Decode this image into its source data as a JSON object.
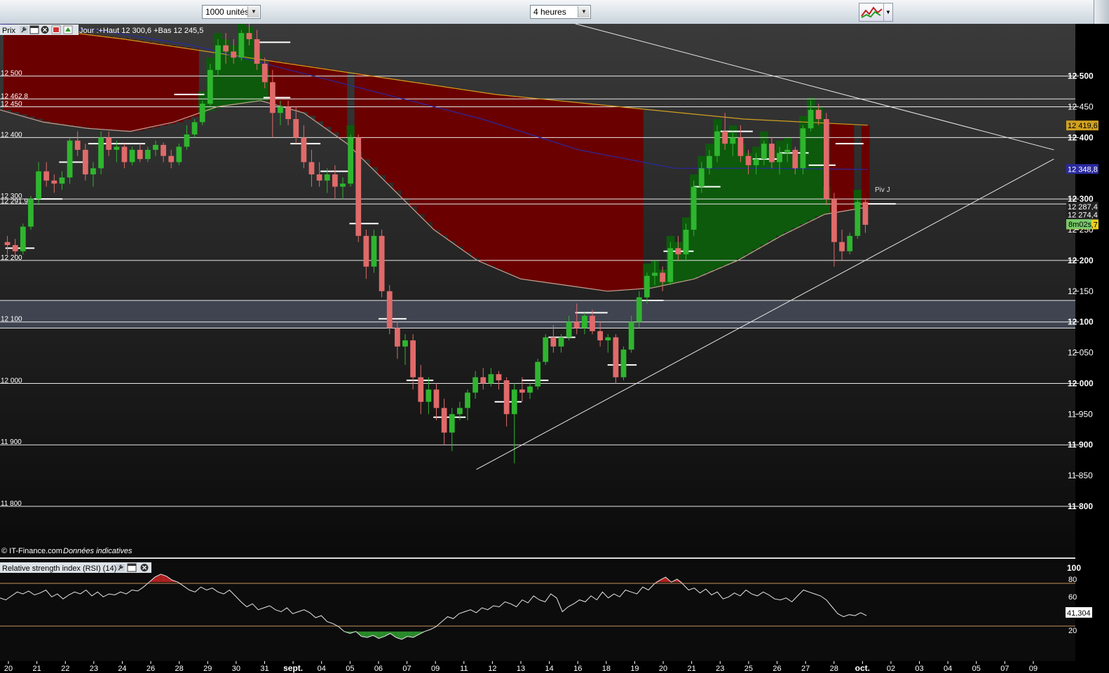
{
  "toolbar": {
    "units_select": "1000 unités",
    "interval_select": "4 heures"
  },
  "price_panel": {
    "label": "Prix",
    "info": "Jour :+Haut 12 300,6 +Bas 12 245,5",
    "copyright": "© IT-Finance.com",
    "disclaimer": "Données indicatives",
    "pivot_label": "Piv J",
    "timer": "8m02s"
  },
  "rsi_panel": {
    "label": "Relative strength index (RSI) (14)",
    "value_label": "41,304",
    "ticks": [
      "100",
      "80",
      "60",
      "20"
    ]
  },
  "colors": {
    "up": "#2fb52f",
    "down": "#e06a6a",
    "ma_slow": "#d0a020",
    "ma_mid": "#2a2aa0",
    "ma_fast": "#c8a090",
    "bear_zone": "#6a0000",
    "bull_zone": "#0d5a0d",
    "highlight_band": "#4a5060"
  },
  "chart_data": {
    "type": "candlestick",
    "ylim": [
      11710,
      12585
    ],
    "y_ticks": [
      "12 500",
      "12 450",
      "12 400",
      "12 350",
      "12 300",
      "12 250",
      "12 200",
      "12 150",
      "12 100",
      "12 050",
      "12 000",
      "11 950",
      "11 900",
      "11 850",
      "11 800"
    ],
    "left_levels": [
      {
        "label": "12 500",
        "value": 12500
      },
      {
        "label": "12 462,8",
        "value": 12462.8
      },
      {
        "label": "12 450",
        "value": 12450
      },
      {
        "label": "12 400",
        "value": 12400
      },
      {
        "label": "12 300",
        "value": 12300
      },
      {
        "label": "12 291,9",
        "value": 12291.9
      },
      {
        "label": "12 200",
        "value": 12200
      },
      {
        "label": "12 100",
        "value": 12100
      },
      {
        "label": "12 000",
        "value": 12000
      },
      {
        "label": "11 900",
        "value": 11900
      },
      {
        "label": "11 800",
        "value": 11800
      }
    ],
    "price_tags": [
      {
        "label": "12 419,6",
        "value": 12419.6,
        "bg": "#d0a020",
        "fg": "#000"
      },
      {
        "label": "12 348,8",
        "value": 12348.8,
        "bg": "#2a2aa0",
        "fg": "#fff"
      },
      {
        "label": "12 287,4",
        "value": 12287.4,
        "bg": "#222",
        "fg": "#fff"
      },
      {
        "label": "12 274,4",
        "value": 12274.4,
        "bg": "#222",
        "fg": "#fff"
      },
      {
        "label": "12 258,7",
        "value": 12258.7,
        "bg": "#e8d020",
        "fg": "#000"
      }
    ],
    "x_ticks": [
      "20",
      "21",
      "22",
      "23",
      "24",
      "26",
      "28",
      "29",
      "30",
      "31",
      "sept.",
      "04",
      "05",
      "06",
      "07",
      "09",
      "11",
      "12",
      "13",
      "14",
      "16",
      "18",
      "19",
      "20",
      "21",
      "23",
      "25",
      "26",
      "27",
      "28",
      "oct.",
      "02",
      "03",
      "04",
      "05",
      "07",
      "09"
    ],
    "highlight_band": [
      12090,
      12135
    ],
    "ohlc": [
      [
        12230,
        12240,
        12210,
        12225
      ],
      [
        12225,
        12235,
        12205,
        12215
      ],
      [
        12215,
        12260,
        12210,
        12255
      ],
      [
        12255,
        12305,
        12250,
        12300
      ],
      [
        12300,
        12360,
        12290,
        12345
      ],
      [
        12345,
        12360,
        12320,
        12330
      ],
      [
        12330,
        12340,
        12310,
        12325
      ],
      [
        12325,
        12345,
        12315,
        12335
      ],
      [
        12335,
        12400,
        12325,
        12395
      ],
      [
        12395,
        12410,
        12370,
        12380
      ],
      [
        12380,
        12390,
        12330,
        12340
      ],
      [
        12340,
        12360,
        12320,
        12350
      ],
      [
        12350,
        12410,
        12340,
        12400
      ],
      [
        12400,
        12410,
        12370,
        12380
      ],
      [
        12380,
        12395,
        12360,
        12385
      ],
      [
        12385,
        12390,
        12350,
        12360
      ],
      [
        12360,
        12385,
        12355,
        12380
      ],
      [
        12380,
        12390,
        12360,
        12365
      ],
      [
        12365,
        12385,
        12360,
        12380
      ],
      [
        12380,
        12395,
        12370,
        12388
      ],
      [
        12388,
        12392,
        12360,
        12370
      ],
      [
        12370,
        12380,
        12350,
        12360
      ],
      [
        12360,
        12390,
        12355,
        12385
      ],
      [
        12385,
        12420,
        12380,
        12405
      ],
      [
        12405,
        12430,
        12400,
        12425
      ],
      [
        12425,
        12460,
        12420,
        12455
      ],
      [
        12455,
        12520,
        12450,
        12510
      ],
      [
        12510,
        12560,
        12500,
        12550
      ],
      [
        12550,
        12570,
        12520,
        12540
      ],
      [
        12540,
        12560,
        12520,
        12530
      ],
      [
        12530,
        12575,
        12525,
        12570
      ],
      [
        12570,
        12585,
        12550,
        12560
      ],
      [
        12560,
        12575,
        12510,
        12520
      ],
      [
        12520,
        12530,
        12480,
        12490
      ],
      [
        12490,
        12510,
        12400,
        12440
      ],
      [
        12440,
        12460,
        12420,
        12450
      ],
      [
        12450,
        12460,
        12420,
        12430
      ],
      [
        12430,
        12450,
        12390,
        12400
      ],
      [
        12400,
        12420,
        12350,
        12360
      ],
      [
        12360,
        12380,
        12320,
        12340
      ],
      [
        12340,
        12360,
        12320,
        12330
      ],
      [
        12330,
        12350,
        12310,
        12340
      ],
      [
        12340,
        12355,
        12300,
        12320
      ],
      [
        12320,
        12335,
        12300,
        12325
      ],
      [
        12325,
        12405,
        12320,
        12400
      ],
      [
        12400,
        12405,
        12230,
        12240
      ],
      [
        12240,
        12250,
        12170,
        12190
      ],
      [
        12190,
        12250,
        12180,
        12240
      ],
      [
        12240,
        12250,
        12140,
        12150
      ],
      [
        12150,
        12160,
        12080,
        12090
      ],
      [
        12090,
        12100,
        12040,
        12060
      ],
      [
        12060,
        12080,
        12030,
        12070
      ],
      [
        12070,
        12080,
        11990,
        12010
      ],
      [
        12010,
        12030,
        11950,
        11970
      ],
      [
        11970,
        12010,
        11950,
        11990
      ],
      [
        11990,
        12000,
        11940,
        11960
      ],
      [
        11960,
        11975,
        11900,
        11920
      ],
      [
        11920,
        11960,
        11890,
        11950
      ],
      [
        11950,
        11970,
        11940,
        11960
      ],
      [
        11960,
        11990,
        11940,
        11985
      ],
      [
        11985,
        12020,
        11975,
        12010
      ],
      [
        12010,
        12025,
        11990,
        12000
      ],
      [
        12000,
        12025,
        11995,
        12015
      ],
      [
        12015,
        12020,
        11990,
        12005
      ],
      [
        12005,
        12010,
        11930,
        11950
      ],
      [
        11950,
        12000,
        11870,
        11990
      ],
      [
        11990,
        12010,
        11970,
        11985
      ],
      [
        11985,
        12000,
        11975,
        11995
      ],
      [
        11995,
        12040,
        11990,
        12035
      ],
      [
        12035,
        12080,
        12030,
        12075
      ],
      [
        12075,
        12095,
        12050,
        12060
      ],
      [
        12060,
        12080,
        12050,
        12075
      ],
      [
        12075,
        12110,
        12070,
        12100
      ],
      [
        12100,
        12130,
        12080,
        12090
      ],
      [
        12090,
        12115,
        12080,
        12110
      ],
      [
        12110,
        12120,
        12080,
        12085
      ],
      [
        12085,
        12100,
        12060,
        12070
      ],
      [
        12070,
        12080,
        12050,
        12075
      ],
      [
        12075,
        12080,
        12000,
        12010
      ],
      [
        12010,
        12060,
        12005,
        12055
      ],
      [
        12055,
        12110,
        12050,
        12100
      ],
      [
        12100,
        12150,
        12090,
        12140
      ],
      [
        12140,
        12180,
        12130,
        12175
      ],
      [
        12175,
        12200,
        12160,
        12180
      ],
      [
        12180,
        12190,
        12150,
        12165
      ],
      [
        12165,
        12230,
        12160,
        12220
      ],
      [
        12220,
        12240,
        12200,
        12210
      ],
      [
        12210,
        12260,
        12200,
        12250
      ],
      [
        12250,
        12330,
        12240,
        12320
      ],
      [
        12320,
        12360,
        12310,
        12350
      ],
      [
        12350,
        12380,
        12340,
        12370
      ],
      [
        12370,
        12420,
        12360,
        12410
      ],
      [
        12410,
        12440,
        12380,
        12390
      ],
      [
        12390,
        12410,
        12370,
        12400
      ],
      [
        12400,
        12420,
        12360,
        12370
      ],
      [
        12370,
        12380,
        12340,
        12355
      ],
      [
        12355,
        12375,
        12340,
        12365
      ],
      [
        12365,
        12395,
        12355,
        12390
      ],
      [
        12390,
        12400,
        12350,
        12360
      ],
      [
        12360,
        12385,
        12340,
        12375
      ],
      [
        12375,
        12390,
        12360,
        12380
      ],
      [
        12380,
        12385,
        12340,
        12350
      ],
      [
        12350,
        12420,
        12340,
        12415
      ],
      [
        12415,
        12460,
        12410,
        12445
      ],
      [
        12445,
        12455,
        12420,
        12430
      ],
      [
        12430,
        12440,
        12290,
        12300
      ],
      [
        12300,
        12310,
        12190,
        12230
      ],
      [
        12230,
        12250,
        12200,
        12215
      ],
      [
        12215,
        12245,
        12210,
        12240
      ],
      [
        12240,
        12300,
        12235,
        12295
      ],
      [
        12295,
        12300,
        12245,
        12258
      ]
    ],
    "ma_slow": [
      12585,
      12560,
      12530,
      12500,
      12470,
      12450,
      12430,
      12420
    ],
    "ma_mid": [
      12585,
      12575,
      12550,
      12510,
      12470,
      12430,
      12380,
      12350,
      12350,
      12348
    ],
    "ma_fast": [
      12445,
      12425,
      12415,
      12410,
      12425,
      12450,
      12460,
      12440,
      12390,
      12320,
      12250,
      12200,
      12170,
      12160,
      12150,
      12155,
      12170,
      12200,
      12240,
      12275,
      12287
    ],
    "pivots": [
      {
        "value": 12220,
        "x0": 0.005,
        "x1": 0.032
      },
      {
        "value": 12300,
        "x0": 0.032,
        "x1": 0.058
      },
      {
        "value": 12390,
        "x0": 0.082,
        "x1": 0.135
      },
      {
        "value": 12360,
        "x0": 0.055,
        "x1": 0.082
      },
      {
        "value": 12470,
        "x0": 0.162,
        "x1": 0.19
      },
      {
        "value": 12555,
        "x0": 0.24,
        "x1": 0.27
      },
      {
        "value": 12465,
        "x0": 0.245,
        "x1": 0.27
      },
      {
        "value": 12390,
        "x0": 0.27,
        "x1": 0.298
      },
      {
        "value": 12345,
        "x0": 0.298,
        "x1": 0.325
      },
      {
        "value": 12260,
        "x0": 0.325,
        "x1": 0.352
      },
      {
        "value": 12105,
        "x0": 0.352,
        "x1": 0.378
      },
      {
        "value": 12005,
        "x0": 0.378,
        "x1": 0.403
      },
      {
        "value": 11945,
        "x0": 0.403,
        "x1": 0.433
      },
      {
        "value": 11970,
        "x0": 0.46,
        "x1": 0.485
      },
      {
        "value": 12005,
        "x0": 0.485,
        "x1": 0.51
      },
      {
        "value": 12075,
        "x0": 0.51,
        "x1": 0.535
      },
      {
        "value": 12115,
        "x0": 0.535,
        "x1": 0.565
      },
      {
        "value": 12030,
        "x0": 0.565,
        "x1": 0.592
      },
      {
        "value": 12135,
        "x0": 0.592,
        "x1": 0.617
      },
      {
        "value": 12215,
        "x0": 0.617,
        "x1": 0.645
      },
      {
        "value": 12320,
        "x0": 0.645,
        "x1": 0.67
      },
      {
        "value": 12410,
        "x0": 0.67,
        "x1": 0.7
      },
      {
        "value": 12365,
        "x0": 0.7,
        "x1": 0.725
      },
      {
        "value": 12375,
        "x0": 0.725,
        "x1": 0.752
      },
      {
        "value": 12355,
        "x0": 0.752,
        "x1": 0.777
      },
      {
        "value": 12390,
        "x0": 0.777,
        "x1": 0.803
      },
      {
        "value": 12292,
        "x0": 0.803,
        "x1": 0.833
      }
    ],
    "trendlines": [
      {
        "from": [
          0.443,
          11860
        ],
        "to": [
          0.98,
          12365
        ]
      },
      {
        "from": [
          0.535,
          12585
        ],
        "to": [
          0.98,
          12380
        ]
      }
    ],
    "rsi": [
      64,
      62,
      66,
      70,
      68,
      71,
      67,
      69,
      72,
      65,
      68,
      63,
      67,
      70,
      68,
      72,
      66,
      70,
      65,
      68,
      67,
      70,
      68,
      72,
      71,
      75,
      80,
      85,
      88,
      86,
      82,
      80,
      76,
      72,
      70,
      75,
      72,
      74,
      70,
      68,
      72,
      66,
      60,
      55,
      58,
      52,
      54,
      56,
      52,
      50,
      54,
      48,
      50,
      52,
      49,
      44,
      46,
      40,
      38,
      35,
      30,
      28,
      30,
      25,
      24,
      26,
      23,
      25,
      28,
      24,
      22,
      25,
      24,
      27,
      30,
      32,
      35,
      40,
      45,
      43,
      48,
      50,
      52,
      49,
      54,
      52,
      56,
      55,
      60,
      58,
      55,
      62,
      59,
      66,
      62,
      60,
      68,
      64,
      50,
      55,
      58,
      62,
      60,
      66,
      62,
      70,
      64,
      68,
      65,
      72,
      70,
      68,
      75,
      72,
      78,
      82,
      85,
      80,
      83,
      78,
      72,
      74,
      69,
      73,
      67,
      70,
      63,
      65,
      69,
      66,
      72,
      68,
      66,
      70,
      67,
      63,
      62,
      64,
      60,
      66,
      72,
      70,
      68,
      66,
      62,
      55,
      48,
      45,
      47,
      46,
      49,
      46
    ]
  }
}
